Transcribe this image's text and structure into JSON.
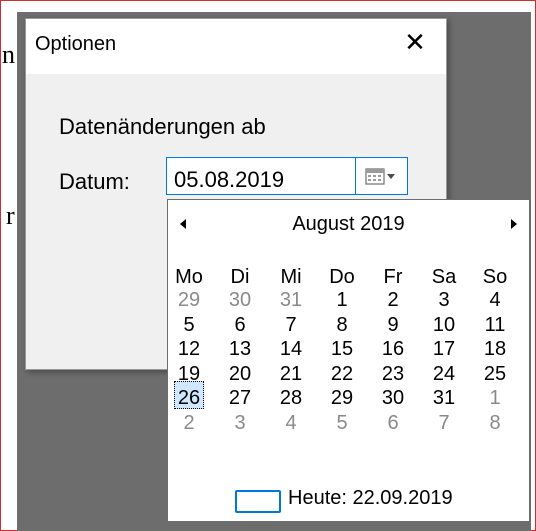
{
  "background": {
    "fragment_1": "n",
    "fragment_2": "r"
  },
  "dialog": {
    "title": "Optionen",
    "close_glyph": "✕",
    "section_label": "Datenänderungen ab",
    "date_label": "Datum:",
    "date_value": "05.08.2019",
    "calendar_button_icon": "calendar-dropdown-icon"
  },
  "calendar": {
    "month_label": "August 2019",
    "prev_glyph": "◀",
    "next_glyph": "▶",
    "weekdays": [
      "Mo",
      "Di",
      "Mi",
      "Do",
      "Fr",
      "Sa",
      "So"
    ],
    "weeks": [
      [
        "29",
        "30",
        "31",
        "1",
        "2",
        "3",
        "4"
      ],
      [
        "5",
        "6",
        "7",
        "8",
        "9",
        "10",
        "11"
      ],
      [
        "12",
        "13",
        "14",
        "15",
        "16",
        "17",
        "18"
      ],
      [
        "19",
        "20",
        "21",
        "22",
        "23",
        "24",
        "25"
      ],
      [
        "26",
        "27",
        "28",
        "29",
        "30",
        "31",
        "1"
      ],
      [
        "2",
        "3",
        "4",
        "5",
        "6",
        "7",
        "8"
      ]
    ],
    "selected_day": "5",
    "today_label": "Heute: 22.09.2019"
  },
  "colors": {
    "accent": "#0078d7",
    "selection": "#cde8ff",
    "muted": "#8a8a8a"
  }
}
